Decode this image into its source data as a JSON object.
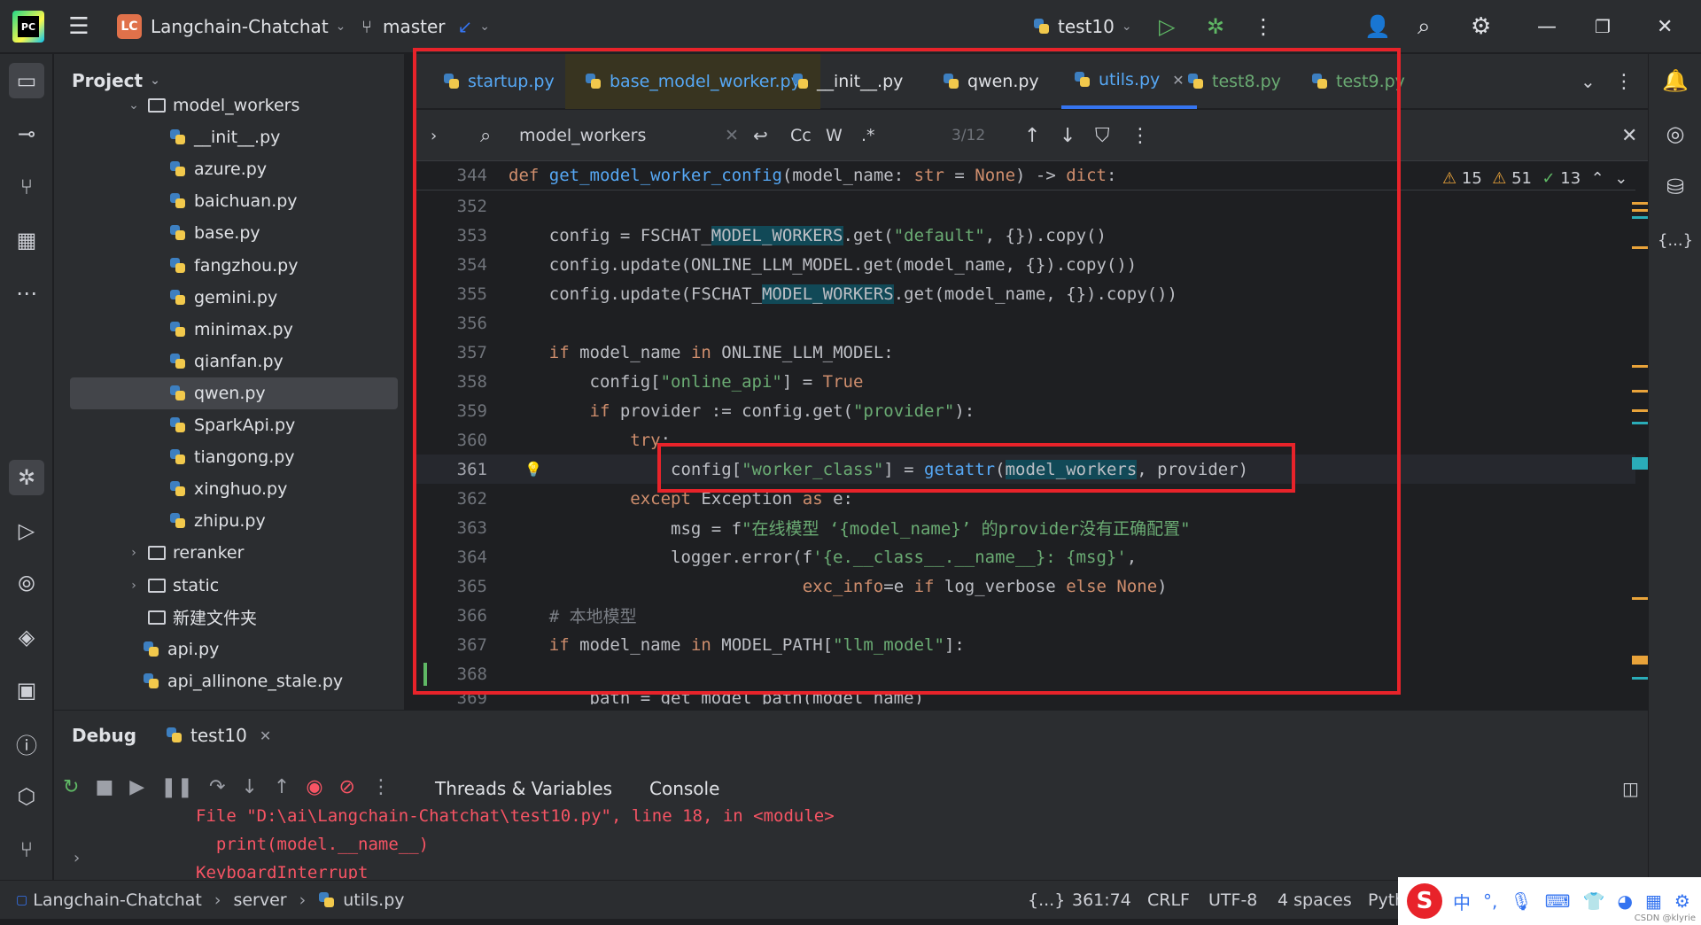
{
  "titlebar": {
    "project_name": "Langchain-Chatchat",
    "project_badge": "LC",
    "branch": "master",
    "run_config": "test10"
  },
  "project_panel": {
    "title": "Project",
    "items": [
      {
        "label": "model_workers",
        "type": "folder",
        "expanded": true
      },
      {
        "label": "__init__.py",
        "type": "py"
      },
      {
        "label": "azure.py",
        "type": "py"
      },
      {
        "label": "baichuan.py",
        "type": "py"
      },
      {
        "label": "base.py",
        "type": "py"
      },
      {
        "label": "fangzhou.py",
        "type": "py"
      },
      {
        "label": "gemini.py",
        "type": "py"
      },
      {
        "label": "minimax.py",
        "type": "py"
      },
      {
        "label": "qianfan.py",
        "type": "py"
      },
      {
        "label": "qwen.py",
        "type": "py",
        "selected": true
      },
      {
        "label": "SparkApi.py",
        "type": "py"
      },
      {
        "label": "tiangong.py",
        "type": "py"
      },
      {
        "label": "xinghuo.py",
        "type": "py"
      },
      {
        "label": "zhipu.py",
        "type": "py"
      },
      {
        "label": "reranker",
        "type": "folder"
      },
      {
        "label": "static",
        "type": "folder"
      },
      {
        "label": "新建文件夹",
        "type": "folder"
      },
      {
        "label": "api.py",
        "type": "py"
      },
      {
        "label": "api_allinone_stale.py",
        "type": "py"
      }
    ]
  },
  "tabs": [
    {
      "label": "startup.py"
    },
    {
      "label": "base_model_worker.py"
    },
    {
      "label": "__init__.py"
    },
    {
      "label": "qwen.py"
    },
    {
      "label": "utils.py",
      "active": true
    },
    {
      "label": "test8.py"
    },
    {
      "label": "test9.py"
    }
  ],
  "find": {
    "query": "model_workers",
    "match_case": "Cc",
    "words": "W",
    "regex": ".*",
    "count": "3/12"
  },
  "inspections": {
    "warnings": "15",
    "weak": "51",
    "ok": "13"
  },
  "code": {
    "sticky_line": "344",
    "sticky_text": "def get_model_worker_config(model_name: str = None) -> dict:",
    "lines": [
      {
        "n": "352",
        "text": ""
      },
      {
        "n": "353",
        "text": "    config = FSCHAT_MODEL_WORKERS.get(\"default\", {}).copy()"
      },
      {
        "n": "354",
        "text": "    config.update(ONLINE_LLM_MODEL.get(model_name, {}).copy())"
      },
      {
        "n": "355",
        "text": "    config.update(FSCHAT_MODEL_WORKERS.get(model_name, {}).copy())"
      },
      {
        "n": "356",
        "text": ""
      },
      {
        "n": "357",
        "text": "    if model_name in ONLINE_LLM_MODEL:"
      },
      {
        "n": "358",
        "text": "        config[\"online_api\"] = True"
      },
      {
        "n": "359",
        "text": "        if provider := config.get(\"provider\"):"
      },
      {
        "n": "360",
        "text": "            try:"
      },
      {
        "n": "361",
        "text": "                config[\"worker_class\"] = getattr(model_workers, provider)"
      },
      {
        "n": "362",
        "text": "            except Exception as e:"
      },
      {
        "n": "363",
        "text": "                msg = f\"在线模型 ‘{model_name}’ 的provider没有正确配置\""
      },
      {
        "n": "364",
        "text": "                logger.error(f'{e.__class__.__name__}: {msg}',"
      },
      {
        "n": "365",
        "text": "                             exc_info=e if log_verbose else None)"
      },
      {
        "n": "366",
        "text": "    # 本地模型"
      },
      {
        "n": "367",
        "text": "    if model_name in MODEL_PATH[\"llm_model\"]:"
      },
      {
        "n": "368",
        "text": ""
      },
      {
        "n": "369",
        "text": "        path = get_model_path(model_name)"
      }
    ]
  },
  "debug": {
    "title": "Debug",
    "session": "test10",
    "tab_threads": "Threads & Variables",
    "tab_console": "Console",
    "console_lines": [
      "File \"D:\\ai\\Langchain-Chatchat\\test10.py\", line 18, in <module>",
      "  print(model.__name__)",
      "KeyboardInterrupt"
    ]
  },
  "statusbar": {
    "crumb_root": "Langchain-Chatchat",
    "crumb_mid": "server",
    "crumb_file": "utils.py",
    "braces": "{...}",
    "position": "361:74",
    "line_sep": "CRLF",
    "encoding": "UTF-8",
    "indent": "4 spaces",
    "lang": "Pyth"
  },
  "ime": {
    "cn": "中",
    "punct": "°,",
    "watermark": "CSDN @klyrie"
  },
  "colors": {
    "accent": "#3574f0",
    "highlight_box": "#e8232a",
    "keyword": "#cf8e6d",
    "string": "#6aab73",
    "function": "#56a8f5"
  }
}
